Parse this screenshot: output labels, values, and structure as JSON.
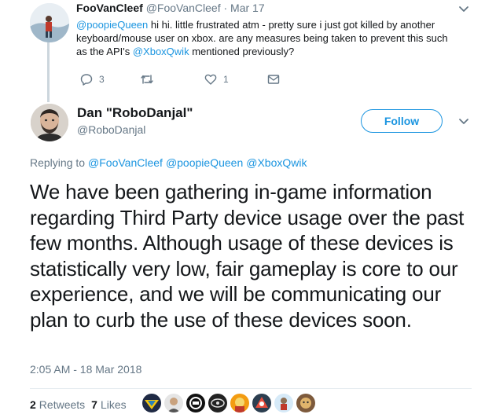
{
  "parent_tweet": {
    "name": "FooVanCleef",
    "handle": "@FooVanCleef",
    "separator": "·",
    "date": "Mar 17",
    "mention": "@poopieQueen",
    "text_before": " hi hi. little frustrated atm - pretty sure i just got killed by another keyboard/mouse user on xbox. are any measures being taken to prevent this such as the API's ",
    "mention2": "@XboxQwik",
    "text_after": " mentioned previously?",
    "reply_count": "3",
    "like_count": "1"
  },
  "main_tweet": {
    "name": "Dan \"RoboDanjal\"",
    "handle": "@RoboDanjal",
    "follow_label": "Follow",
    "replying_label": "Replying to",
    "replying_to": [
      "@FooVanCleef",
      "@poopieQueen",
      "@XboxQwik"
    ],
    "body": "We have been gathering in-game information regarding Third Party device usage over the past few months. Although usage of these devices is statistically very low, fair gameplay is core to our experience, and we will be communicating our plan to curb the use of these devices soon.",
    "timestamp": "2:05 AM - 18 Mar 2018",
    "retweet_count": "2",
    "retweet_label": "Retweets",
    "like_count": "7",
    "like_label": "Likes"
  },
  "colors": {
    "link": "#1b95e0",
    "secondary_text": "#657786",
    "primary_text": "#14171a"
  },
  "icons": [
    "reply-icon",
    "retweet-icon",
    "like-icon",
    "direct-message-icon",
    "chevron-down-icon"
  ]
}
